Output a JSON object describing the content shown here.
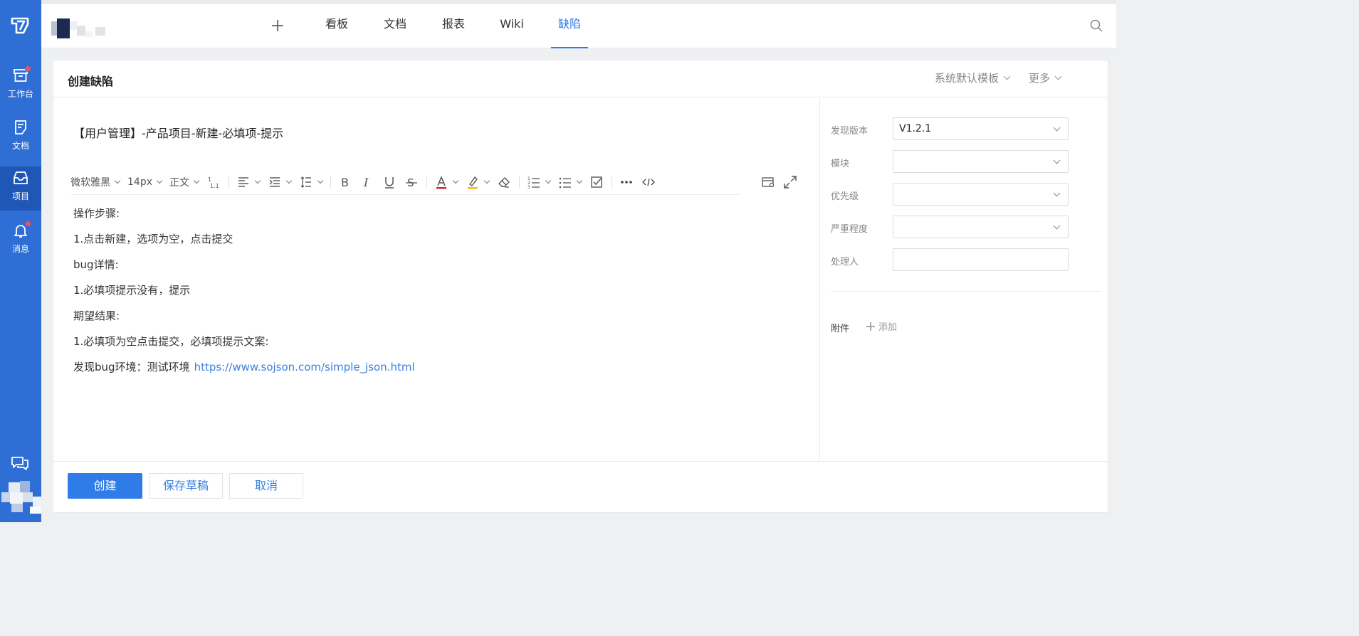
{
  "leftnav": {
    "items": [
      {
        "label": "工作台",
        "icon": "archive-icon",
        "badge": true
      },
      {
        "label": "文档",
        "icon": "document-icon",
        "badge": false
      },
      {
        "label": "项目",
        "icon": "inbox-icon",
        "badge": false,
        "active": true
      },
      {
        "label": "消息",
        "icon": "bell-icon",
        "badge": true
      }
    ]
  },
  "topbar": {
    "tabs": [
      {
        "label": "看板"
      },
      {
        "label": "文档"
      },
      {
        "label": "报表"
      },
      {
        "label": "Wiki"
      },
      {
        "label": "缺陷",
        "active": true
      }
    ]
  },
  "card": {
    "title": "创建缺陷",
    "template_label": "系统默认模板",
    "more_label": "更多"
  },
  "editor": {
    "title": "【用户管理】-产品项目-新建-必填项-提示",
    "toolbar": {
      "font": "微软雅黑",
      "size": "14px",
      "paragraph": "正文"
    },
    "lines": [
      "操作步骤:",
      "1.点击新建，选项为空，点击提交",
      "bug详情:",
      "1.必填项提示没有，提示",
      "期望结果:",
      "1.必填项为空点击提交，必填项提示文案:"
    ],
    "last_line_text": "发现bug环境：测试环境",
    "last_line_link": "https://www.sojson.com/simple_json.html"
  },
  "fields": [
    {
      "label": "发现版本",
      "value": "V1.2.1",
      "type": "select"
    },
    {
      "label": "模块",
      "value": "",
      "type": "select"
    },
    {
      "label": "优先级",
      "value": "",
      "type": "select"
    },
    {
      "label": "严重程度",
      "value": "",
      "type": "select"
    },
    {
      "label": "处理人",
      "value": "",
      "type": "input"
    }
  ],
  "attachment": {
    "label": "附件",
    "add_label": "添加"
  },
  "footer": {
    "create": "创建",
    "save_draft": "保存草稿",
    "cancel": "取消"
  },
  "colors": {
    "nav_bg": "#2f6fd5",
    "nav_active": "#1f57b6",
    "accent": "#2f7ce8",
    "badge": "#ff4d4f"
  }
}
